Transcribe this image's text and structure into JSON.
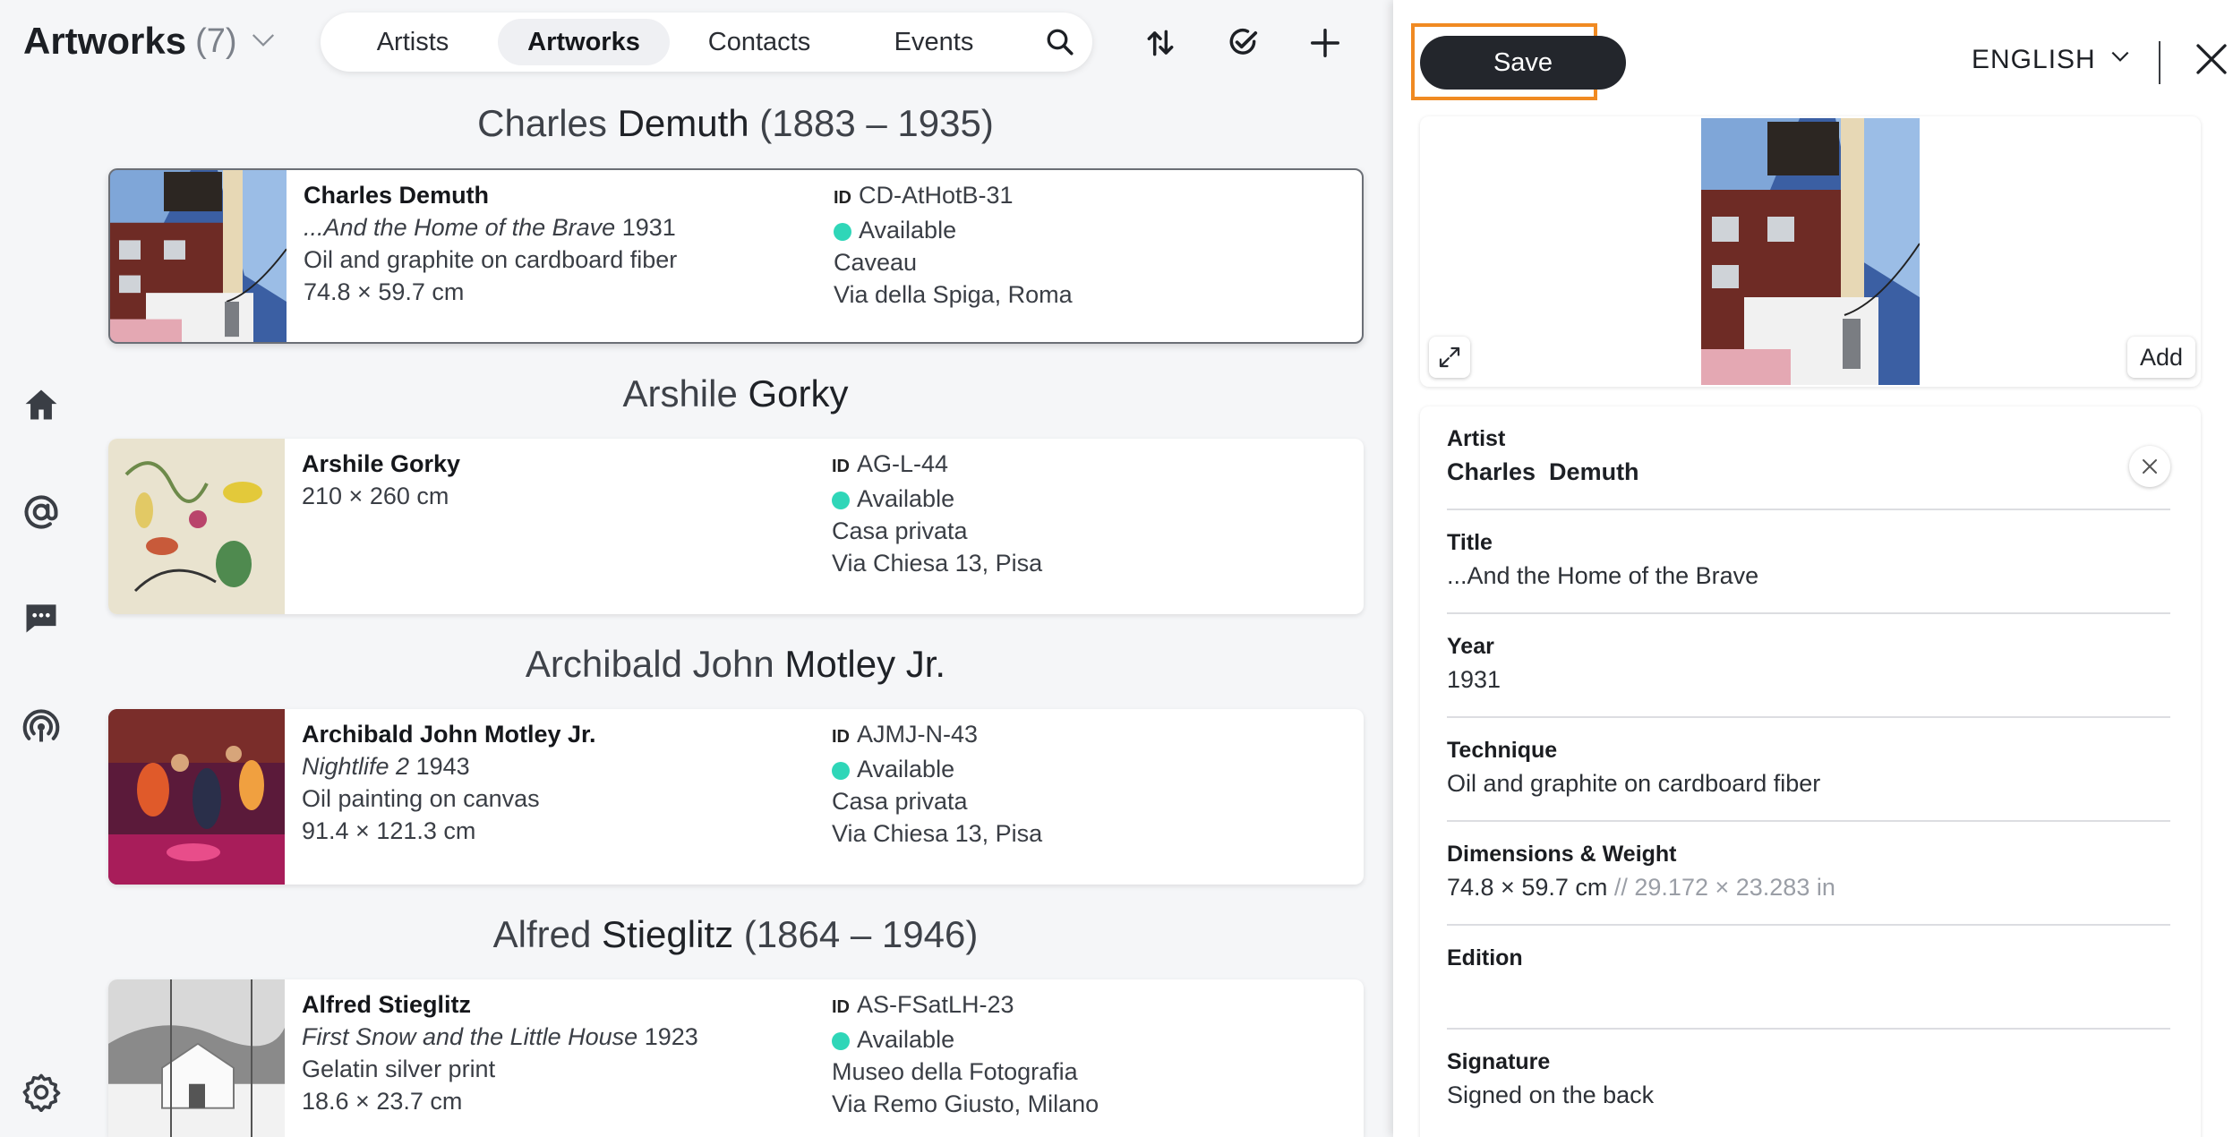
{
  "header": {
    "title": "Artworks",
    "count": "(7)",
    "nav_tabs": [
      "Artists",
      "Artworks",
      "Contacts",
      "Events"
    ],
    "active_tab": "Artworks"
  },
  "sidebar": {
    "icons": [
      "home-icon",
      "at-sign-icon",
      "chat-icon",
      "broadcast-icon",
      "settings-icon"
    ]
  },
  "toolbar": {
    "icons": [
      "sort-icon",
      "check-circle-icon",
      "add-icon"
    ]
  },
  "artists": [
    {
      "first": "Charles",
      "last": "Demuth",
      "years": "(1883 – 1935)",
      "card": {
        "name": "Charles Demuth",
        "title": "...And the Home of the Brave",
        "year": "1931",
        "technique": "Oil and graphite on cardboard fiber",
        "dimensions": "74.8 × 59.7 cm",
        "id_label": "ID",
        "id": "CD-AtHotB-31",
        "status": "Available",
        "location": "Caveau",
        "address": "Via della Spiga, Roma"
      }
    },
    {
      "first": "Arshile",
      "last": "Gorky",
      "years": "",
      "card": {
        "name": "Arshile Gorky",
        "dimensions": "210 × 260 cm",
        "id_label": "ID",
        "id": "AG-L-44",
        "status": "Available",
        "location": "Casa privata",
        "address": "Via Chiesa 13, Pisa"
      }
    },
    {
      "first": "Archibald John",
      "last": "Motley Jr.",
      "years": "",
      "card": {
        "name": "Archibald John Motley Jr.",
        "title": "Nightlife 2",
        "year": "1943",
        "technique": "Oil painting on canvas",
        "dimensions": "91.4 × 121.3 cm",
        "id_label": "ID",
        "id": "AJMJ-N-43",
        "status": "Available",
        "location": "Casa privata",
        "address": "Via Chiesa 13, Pisa"
      }
    },
    {
      "first": "Alfred",
      "last": "Stieglitz",
      "years": "(1864 – 1946)",
      "card": {
        "name": "Alfred Stieglitz",
        "title": "First Snow and the Little House",
        "year": "1923",
        "technique": "Gelatin silver print",
        "dimensions": "18.6 × 23.7 cm",
        "id_label": "ID",
        "id": "AS-FSatLH-23",
        "status": "Available",
        "location": "Museo della Fotografia",
        "address": "Via Remo Giusto, Milano"
      }
    }
  ],
  "panel": {
    "save_label": "Save",
    "language": "ENGLISH",
    "add_label": "Add",
    "fields": [
      {
        "label": "Artist",
        "value": "Charles  Demuth"
      },
      {
        "label": "Title",
        "value": "...And the Home of the Brave"
      },
      {
        "label": "Year",
        "value": "1931"
      },
      {
        "label": "Technique",
        "value": "Oil and graphite on cardboard fiber"
      },
      {
        "label": "Dimensions & Weight",
        "value": "74.8 × 59.7 cm",
        "value_secondary": "// 29.172 × 23.283 in"
      },
      {
        "label": "Edition",
        "value": ""
      },
      {
        "label": "Signature",
        "value": "Signed on the back"
      }
    ]
  },
  "colors": {
    "accent_highlight": "#f08a22",
    "status_available": "#2fd6b8",
    "button_dark": "#23262c"
  }
}
